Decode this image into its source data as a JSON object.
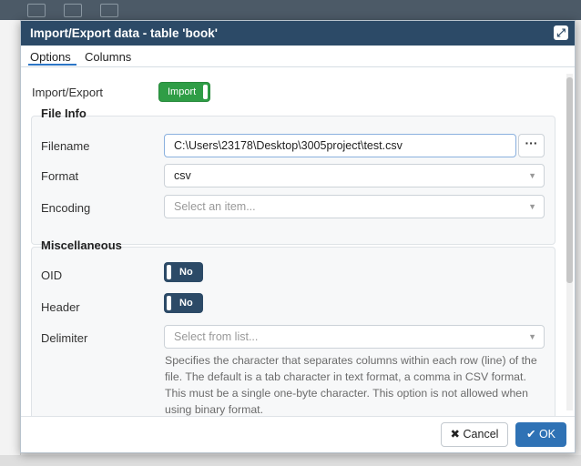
{
  "dialog": {
    "title": "Import/Export data - table 'book'",
    "maximize_icon": "maximize-icon"
  },
  "tabs": [
    {
      "label": "Options",
      "active": true
    },
    {
      "label": "Columns",
      "active": false
    }
  ],
  "import_export": {
    "label": "Import/Export",
    "value": "Import"
  },
  "file_info": {
    "title": "File Info",
    "filename_label": "Filename",
    "filename_value": "C:\\Users\\23178\\Desktop\\3005project\\test.csv",
    "browse_label": "···",
    "format_label": "Format",
    "format_value": "csv",
    "encoding_label": "Encoding",
    "encoding_placeholder": "Select an item..."
  },
  "misc": {
    "title": "Miscellaneous",
    "oid_label": "OID",
    "oid_value": "No",
    "header_label": "Header",
    "header_value": "No",
    "delimiter_label": "Delimiter",
    "delimiter_placeholder": "Select from list...",
    "delimiter_help": "Specifies the character that separates columns within each row (line) of the file. The default is a tab character in text format, a comma in CSV format. This must be a single one-byte character. This option is not allowed when using binary format."
  },
  "footer": {
    "cancel_label": "Cancel",
    "ok_label": "OK"
  },
  "colors": {
    "titlebar": "#2c4a67",
    "import_toggle": "#2f9d46",
    "ok_button": "#2f72b5"
  }
}
